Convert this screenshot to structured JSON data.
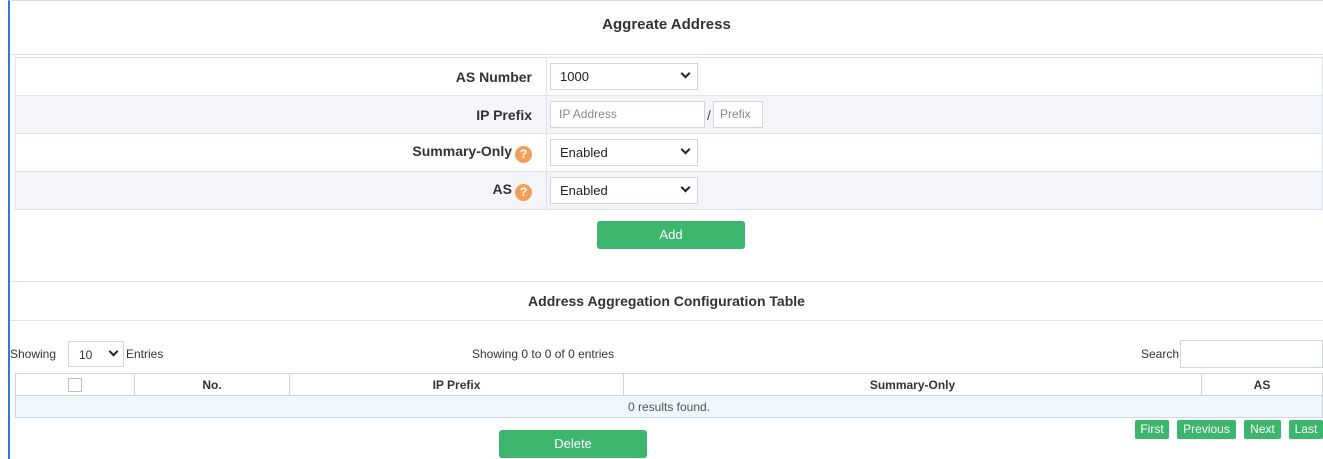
{
  "title": "Aggreate Address",
  "form": {
    "as_number": {
      "label": "AS Number",
      "value": "1000"
    },
    "ip_prefix": {
      "label": "IP Prefix",
      "ip_placeholder": "IP Address",
      "separator": "/",
      "prefix_placeholder": "Prefix"
    },
    "summary_only": {
      "label": "Summary-Only",
      "value": "Enabled",
      "help": "?"
    },
    "as_set": {
      "label": "AS",
      "value": "Enabled",
      "help": "?"
    },
    "add_label": "Add"
  },
  "table_section": {
    "title": "Address Aggregation Configuration Table",
    "showing_label": "Showing",
    "page_size": "10",
    "entries_label": "Entries",
    "info": "Showing 0 to 0 of 0 entries",
    "search_label": "Search",
    "columns": [
      "No.",
      "IP Prefix",
      "Summary-Only",
      "AS"
    ],
    "empty_message": "0 results found.",
    "delete_label": "Delete",
    "pager": {
      "first": "First",
      "previous": "Previous",
      "next": "Next",
      "last": "Last"
    }
  },
  "colors": {
    "accent_green": "#3db66d",
    "help_orange": "#f0a05a",
    "frame_blue": "#2e7bd6"
  },
  "icons": [
    "help-icon",
    "chevron-down-icon",
    "checkbox"
  ]
}
